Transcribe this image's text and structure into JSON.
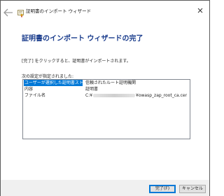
{
  "window": {
    "title": "証明書のインポート ウィザード"
  },
  "content": {
    "heading": "証明書のインポート ウィザードの完了",
    "info": "[完了] をクリックすると、証明書がインポートされます。",
    "list_caption": "次の設定が指定されました:",
    "settings": [
      {
        "key": "ユーザーが選択した証明書ストア",
        "value": "信頼されたルート証明機関"
      },
      {
        "key": "内容",
        "value": "証明書"
      },
      {
        "key": "ファイル名",
        "value_prefix": "C:¥",
        "value_suffix": "¥owasp_zap_root_ca.cer"
      }
    ]
  },
  "footer": {
    "finish_label": "完了(F)",
    "cancel_label": "キャンセル"
  },
  "icons": {
    "back": "back-arrow-icon",
    "certificate": "certificate-icon",
    "close": "close-icon"
  },
  "colors": {
    "heading": "#1a3c8c",
    "selection": "#0078d7",
    "footer_bg": "#f0f0f0"
  }
}
